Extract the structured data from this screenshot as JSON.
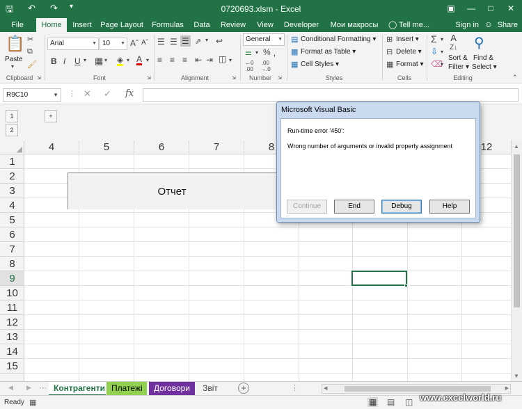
{
  "titlebar": {
    "title": "0720693.xlsm - Excel"
  },
  "tabs": [
    "File",
    "Home",
    "Insert",
    "Page Layout",
    "Formulas",
    "Data",
    "Review",
    "View",
    "Developer",
    "Мои макросы"
  ],
  "tellme": "Tell me...",
  "signin": "Sign in",
  "share": "Share",
  "ribbon": {
    "paste": "Paste",
    "clipboard": "Clipboard",
    "font_name": "Arial",
    "font_size": "10",
    "font": "Font",
    "alignment": "Alignment",
    "number_format": "General",
    "number": "Number",
    "cond_format": "Conditional Formatting",
    "format_table": "Format as Table",
    "cell_styles": "Cell Styles",
    "styles": "Styles",
    "insert": "Insert",
    "delete": "Delete",
    "format": "Format",
    "cells": "Cells",
    "sort_filter_1": "Sort &",
    "sort_filter_2": "Filter",
    "find_select_1": "Find &",
    "find_select_2": "Select",
    "editing": "Editing",
    "bold": "B",
    "italic": "I",
    "underline": "U"
  },
  "formula_bar": {
    "name_box": "R9C10",
    "fx": "fx",
    "value": ""
  },
  "outline": {
    "level1": "1",
    "level2": "2",
    "expand": "+"
  },
  "columns": [
    "4",
    "5",
    "6",
    "7",
    "8",
    "12"
  ],
  "rows": [
    "1",
    "2",
    "3",
    "4",
    "5",
    "6",
    "7",
    "8",
    "9",
    "10",
    "11",
    "12",
    "13",
    "14",
    "15"
  ],
  "report_label": "Отчет",
  "dialog": {
    "title": "Microsoft Visual Basic",
    "error": "Run-time error '450':",
    "message": "Wrong number of arguments or invalid property assignment",
    "buttons": {
      "continue": "Continue",
      "end": "End",
      "debug": "Debug",
      "help": "Help"
    }
  },
  "sheets": [
    {
      "name": "Контрагенти",
      "color": "#ffffff",
      "text": "#217346"
    },
    {
      "name": "Платежі",
      "color": "#92d050",
      "text": "#000000"
    },
    {
      "name": "Договори",
      "color": "#7030a0",
      "text": "#ffffff"
    },
    {
      "name": "Звіт",
      "color": "#f3f3f3",
      "text": "#444444"
    }
  ],
  "status": {
    "ready": "Ready",
    "watermark": "www.excelworld.ru"
  },
  "colors": {
    "accent": "#217346"
  }
}
